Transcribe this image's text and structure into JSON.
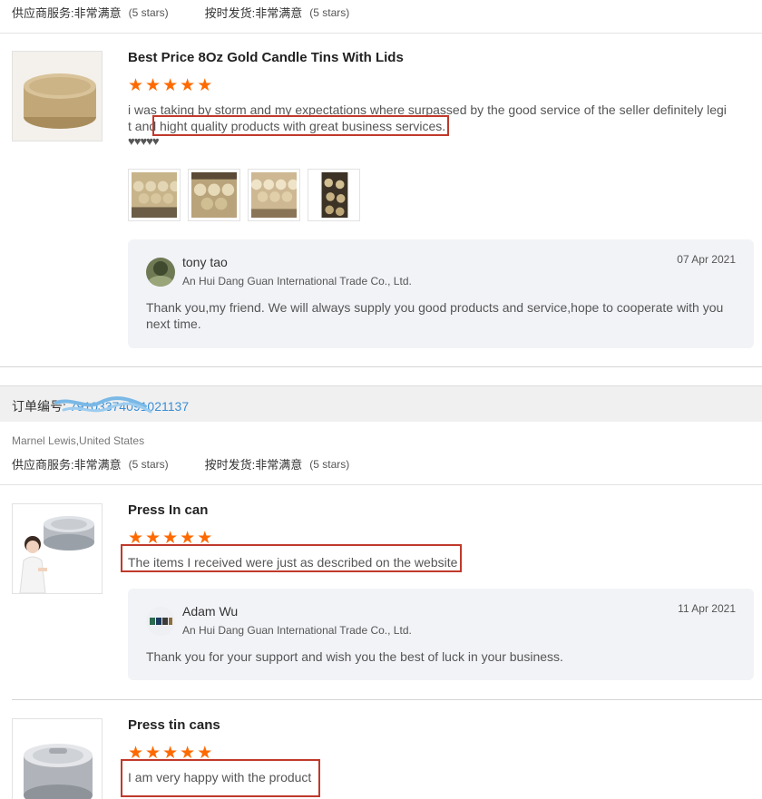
{
  "top_ratings": {
    "supplier_service_label": "供应商服务:",
    "supplier_service_value": "非常满意",
    "supplier_service_stars": "(5 stars)",
    "shipping_label": "按时发货:",
    "shipping_value": "非常满意",
    "shipping_stars": "(5 stars)"
  },
  "review1": {
    "title": "Best Price 8Oz Gold Candle Tins With Lids",
    "stars": 5,
    "text_line1": "i was taking by storm and my expectations where surpassed by the good service of the seller definitely legi",
    "text_line2_a": "t and ",
    "text_line2_b": "hight quality products with great business services.",
    "hearts": "♥♥♥♥♥",
    "reply": {
      "name": "tony tao",
      "company": "An Hui Dang Guan International Trade Co., Ltd.",
      "date": "07 Apr 2021",
      "message": "Thank you,my friend. We will always supply you good products and service,hope to cooperate with you next time."
    }
  },
  "order": {
    "label": "订单编号:",
    "number": "79103374091021137"
  },
  "buyer": {
    "name": "Marnel Lewis,United States"
  },
  "mid_ratings": {
    "supplier_service_label": "供应商服务:",
    "supplier_service_value": "非常满意",
    "supplier_service_stars": "(5 stars)",
    "shipping_label": "按时发货:",
    "shipping_value": "非常满意",
    "shipping_stars": "(5 stars)"
  },
  "review2": {
    "title": "Press In can",
    "stars": 5,
    "text": "The items I received were just as described on the website",
    "reply": {
      "name": "Adam Wu",
      "company": "An Hui Dang Guan International Trade Co., Ltd.",
      "date": "11 Apr 2021",
      "message": "Thank you for your support and wish you the best of luck in your business."
    }
  },
  "review3": {
    "title": "Press tin cans",
    "stars": 5,
    "text": "I am very happy with the product"
  },
  "colors": {
    "star": "#ff6a00",
    "highlight_box": "#c0392b",
    "order_number": "#3a8ed6",
    "reply_bg": "#f2f3f7"
  }
}
